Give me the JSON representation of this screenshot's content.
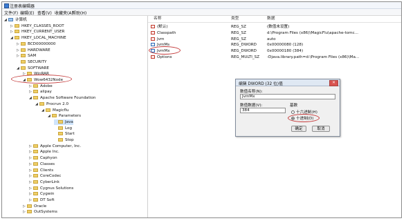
{
  "window": {
    "title": "注册表编辑器"
  },
  "menu": [
    "文件(F)",
    "编辑(E)",
    "查看(V)",
    "收藏夹(A)",
    "帮助(H)"
  ],
  "tree": [
    {
      "label": "计算机",
      "level": 0,
      "arrow": "◢",
      "kind": "pc"
    },
    {
      "label": "HKEY_CLASSES_ROOT",
      "level": 1,
      "arrow": "▷",
      "kind": "folder"
    },
    {
      "label": "HKEY_CURRENT_USER",
      "level": 1,
      "arrow": "▷",
      "kind": "folder"
    },
    {
      "label": "HKEY_LOCAL_MACHINE",
      "level": 1,
      "arrow": "◢",
      "kind": "folder"
    },
    {
      "label": "BCD00000000",
      "level": 2,
      "arrow": "▷",
      "kind": "folder"
    },
    {
      "label": "HARDWARE",
      "level": 2,
      "arrow": "▷",
      "kind": "folder"
    },
    {
      "label": "SAM",
      "level": 2,
      "arrow": "▷",
      "kind": "folder"
    },
    {
      "label": "SECURITY",
      "level": 2,
      "arrow": "",
      "kind": "folder"
    },
    {
      "label": "SOFTWARE",
      "level": 2,
      "arrow": "◢",
      "kind": "folder"
    },
    {
      "label": "WinRAR",
      "level": 3,
      "arrow": "▷",
      "kind": "folder"
    },
    {
      "label": "Wow6432Node",
      "level": 3,
      "arrow": "◢",
      "kind": "folder"
    },
    {
      "label": "Adobe",
      "level": 4,
      "arrow": "▷",
      "kind": "folder"
    },
    {
      "label": "alipay",
      "level": 4,
      "arrow": "▷",
      "kind": "folder"
    },
    {
      "label": "Apache Software Foundation",
      "level": 4,
      "arrow": "◢",
      "kind": "folder"
    },
    {
      "label": "Procrun 2.0",
      "level": 5,
      "arrow": "◢",
      "kind": "folder"
    },
    {
      "label": "Magicflu",
      "level": 6,
      "arrow": "◢",
      "kind": "folder"
    },
    {
      "label": "Parameters",
      "level": 7,
      "arrow": "◢",
      "kind": "folder"
    },
    {
      "label": "Java",
      "level": 8,
      "arrow": "",
      "kind": "folder",
      "selected": true
    },
    {
      "label": "Log",
      "level": 8,
      "arrow": "",
      "kind": "folder"
    },
    {
      "label": "Start",
      "level": 8,
      "arrow": "",
      "kind": "folder"
    },
    {
      "label": "Stop",
      "level": 8,
      "arrow": "",
      "kind": "folder"
    },
    {
      "label": "Apple Computer, Inc.",
      "level": 4,
      "arrow": "▷",
      "kind": "folder"
    },
    {
      "label": "Apple Inc.",
      "level": 4,
      "arrow": "▷",
      "kind": "folder"
    },
    {
      "label": "Caphyon",
      "level": 4,
      "arrow": "▷",
      "kind": "folder"
    },
    {
      "label": "Classes",
      "level": 4,
      "arrow": "▷",
      "kind": "folder"
    },
    {
      "label": "Clients",
      "level": 4,
      "arrow": "▷",
      "kind": "folder"
    },
    {
      "label": "CoreCodec",
      "level": 4,
      "arrow": "▷",
      "kind": "folder"
    },
    {
      "label": "CyberLink",
      "level": 4,
      "arrow": "▷",
      "kind": "folder"
    },
    {
      "label": "Cygnus Solutions",
      "level": 4,
      "arrow": "▷",
      "kind": "folder"
    },
    {
      "label": "Cygwin",
      "level": 4,
      "arrow": "▷",
      "kind": "folder"
    },
    {
      "label": "DT Soft",
      "level": 4,
      "arrow": "▷",
      "kind": "folder"
    },
    {
      "label": "Oracle",
      "level": 3,
      "arrow": "▷",
      "kind": "folder"
    },
    {
      "label": "OutSystems",
      "level": 3,
      "arrow": "▷",
      "kind": "folder"
    }
  ],
  "columns": {
    "name": "名称",
    "type": "类型",
    "data": "数据"
  },
  "values": [
    {
      "name": "(默认)",
      "type": "REG_SZ",
      "data": "(数值未设置)",
      "icon": "str"
    },
    {
      "name": "Classpath",
      "type": "REG_SZ",
      "data": "d:\\Program Files (x86)\\MagicFlu\\apache-tomc...",
      "icon": "str"
    },
    {
      "name": "Jvm",
      "type": "REG_SZ",
      "data": "auto",
      "icon": "str"
    },
    {
      "name": "JvmMs",
      "type": "REG_DWORD",
      "data": "0x00000080 (128)",
      "icon": "bin"
    },
    {
      "name": "JvmMx",
      "type": "REG_DWORD",
      "data": "0x00000180 (384)",
      "icon": "bin"
    },
    {
      "name": "Options",
      "type": "REG_MULTI_SZ",
      "data": "-Djava.library.path=d:\\Program Files (x86)\\Ma...",
      "icon": "str"
    }
  ],
  "dialog": {
    "title": "编辑 DWORD (32 位)值",
    "close_label": "✕",
    "name_label": "数值名称(N):",
    "name_value": "JvmMx",
    "data_label": "数值数据(V):",
    "data_value": "384",
    "base_label": "基数",
    "hex_label": "十六进制(H)",
    "dec_label": "十进制(D)",
    "selected_base": "dec",
    "ok_label": "确定",
    "cancel_label": "取消"
  },
  "annotation_color": "#c43a3a"
}
